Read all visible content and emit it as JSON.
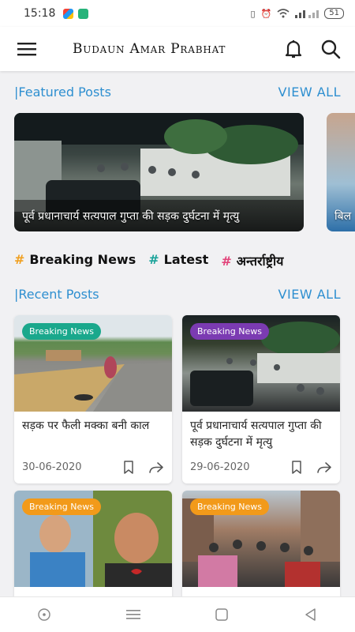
{
  "status_bar": {
    "time": "15:18",
    "battery": "51"
  },
  "app": {
    "title": "Budaun Amar Prabhat"
  },
  "featured": {
    "title": "|Featured Posts",
    "view_all": "VIEW ALL",
    "posts": [
      {
        "title": "पूर्व प्रधानाचार्य सत्यपाल गुप्ता की सड़क दुर्घटना में मृत्यु"
      },
      {
        "title": "बिल"
      }
    ]
  },
  "tags": [
    {
      "label": "Breaking News",
      "color": "#f0a021"
    },
    {
      "label": "Latest",
      "color": "#1aa39a"
    },
    {
      "label": "अन्तर्राष्ट्रीय",
      "color": "#e2447a"
    }
  ],
  "recent": {
    "title": "|Recent Posts",
    "view_all": "VIEW ALL",
    "posts": [
      {
        "badge": "Breaking News",
        "badge_color": "#1aa88c",
        "title": "सड़क पर फैली मक्का बनी काल",
        "date": "30-06-2020"
      },
      {
        "badge": "Breaking News",
        "badge_color": "#7b3bb2",
        "title": "पूर्व प्रधानाचार्य सत्यपाल गुप्ता की सड़क दुर्घटना में मृत्यु",
        "date": "29-06-2020"
      },
      {
        "badge": "Breaking News",
        "badge_color": "#f29a1a",
        "title": "",
        "date": ""
      },
      {
        "badge": "Breaking News",
        "badge_color": "#f29a1a",
        "title": "",
        "date": ""
      }
    ]
  },
  "icons": {
    "menu": "hamburger-menu-icon",
    "bell": "bell-icon",
    "search": "search-icon",
    "bookmark": "bookmark-icon",
    "share": "share-icon"
  }
}
